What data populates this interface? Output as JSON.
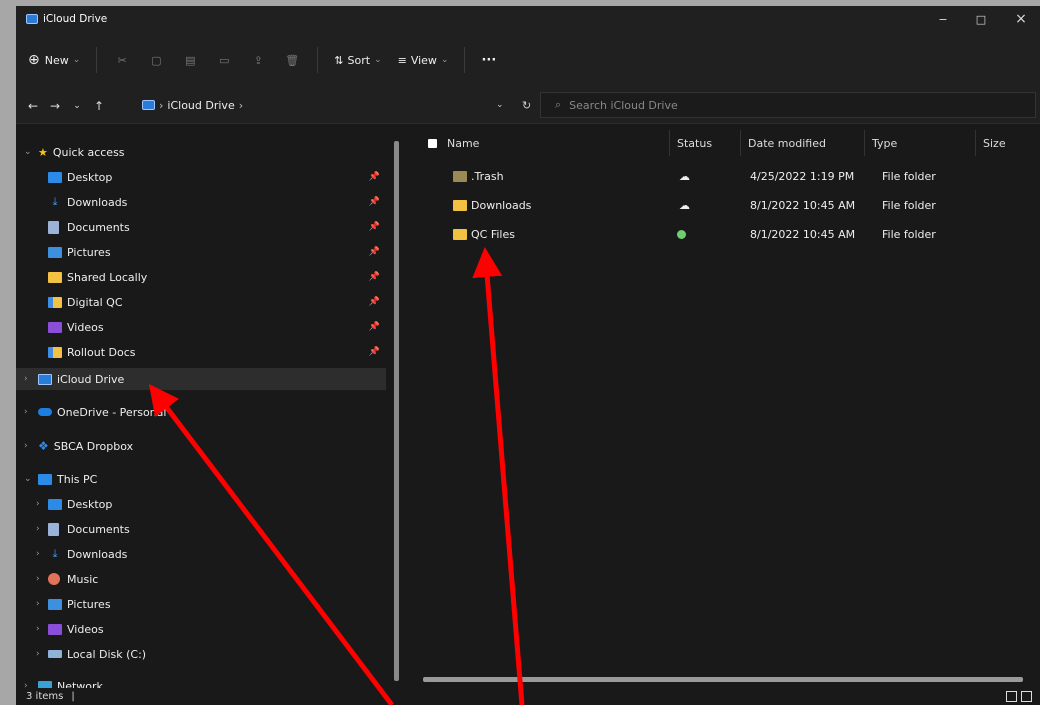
{
  "window": {
    "title": "iCloud Drive",
    "minimize_icon": "−",
    "maximize_icon": "□",
    "close_icon": "×"
  },
  "toolbar": {
    "new_label": "New",
    "new_chevron": "⌄",
    "sort_label": "Sort",
    "sort_chevron": "⌄",
    "view_label": "View",
    "view_chevron": "⌄",
    "more_label": "···"
  },
  "address": {
    "path": "iCloud Drive",
    "separator": "›",
    "search_placeholder": "Search iCloud Drive"
  },
  "sidebar": {
    "quick_access": "Quick access",
    "quick_items": [
      "Desktop",
      "Downloads",
      "Documents",
      "Pictures",
      "Shared Locally",
      "Digital QC",
      "Videos",
      "Rollout Docs"
    ],
    "icloud": "iCloud Drive",
    "onedrive": "OneDrive - Personal",
    "dropbox": "SBCA Dropbox",
    "this_pc": "This PC",
    "pc_items": [
      "Desktop",
      "Documents",
      "Downloads",
      "Music",
      "Pictures",
      "Videos",
      "Local Disk (C:)"
    ],
    "network": "Network"
  },
  "columns": {
    "name": "Name",
    "status": "Status",
    "date": "Date modified",
    "type": "Type",
    "size": "Size"
  },
  "files": [
    {
      "name": ".Trash",
      "status": "cloud",
      "date": "4/25/2022 1:19 PM",
      "type": "File folder",
      "size": ""
    },
    {
      "name": "Downloads",
      "status": "cloud",
      "date": "8/1/2022 10:45 AM",
      "type": "File folder",
      "size": ""
    },
    {
      "name": "QC Files",
      "status": "synced",
      "date": "8/1/2022 10:45 AM",
      "type": "File folder",
      "size": ""
    }
  ],
  "status_bar": {
    "items": "3 items",
    "cursor": "|"
  },
  "colors": {
    "annotation": "#ff0000",
    "folder": "#f4c242",
    "accent": "#0a84ff"
  }
}
